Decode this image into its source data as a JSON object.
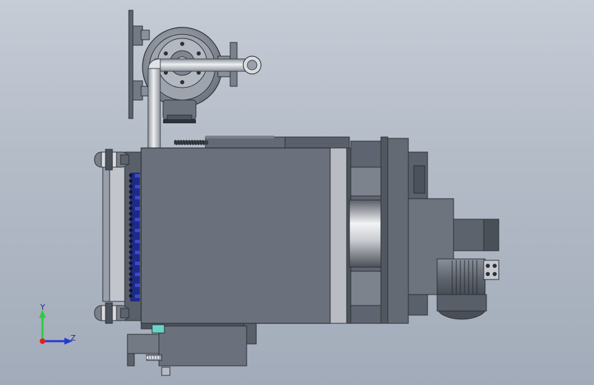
{
  "triad": {
    "y_label": "Y",
    "z_label": "Z",
    "colors": {
      "y_axis": "#2ecc40",
      "z_axis": "#1f3bd6",
      "x_axis": "#e02020"
    }
  },
  "model": {
    "colors": {
      "body": "#6b717c",
      "body_dark": "#4d535d",
      "frame": "#5f6570",
      "edge": "#2b2f36",
      "rail": "#9aa0aa",
      "pipe": "#c8ccd2",
      "pump": "#8a909a",
      "accent_blue": "#2230b8",
      "accent_teal": "#6ad4c8",
      "roller": "#d8dade"
    }
  }
}
